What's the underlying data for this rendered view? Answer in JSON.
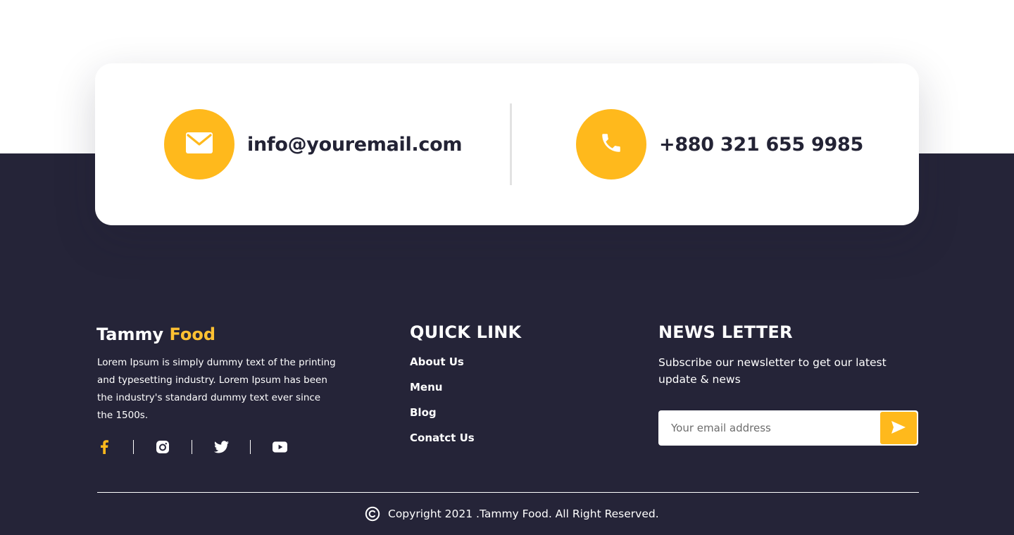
{
  "contact": {
    "email": "info@youremail.com",
    "phone": "+880 321 655 9985"
  },
  "footer": {
    "brand": {
      "name": "Tammy",
      "accent": "Food"
    },
    "about": "Lorem Ipsum is simply dummy text of the printing and typesetting industry. Lorem Ipsum has been the industry's standard dummy text ever since the 1500s.",
    "social": [
      "facebook-icon",
      "instagram-icon",
      "twitter-icon",
      "youtube-icon"
    ],
    "quick_link": {
      "title": "QUICK LINK",
      "items": [
        {
          "label": "About Us"
        },
        {
          "label": "Menu"
        },
        {
          "label": "Blog"
        },
        {
          "label": "Conatct Us"
        }
      ]
    },
    "newsletter": {
      "title": "NEWS LETTER",
      "description": "Subscribe our newsletter to get our latest update & news",
      "placeholder": "Your email address"
    },
    "copyright": "Copyright 2021 .Tammy Food. All Right Reserved."
  },
  "colors": {
    "accent": "#FFB91C",
    "footer_bg": "#252438",
    "brand_accent": "#FFC132"
  }
}
